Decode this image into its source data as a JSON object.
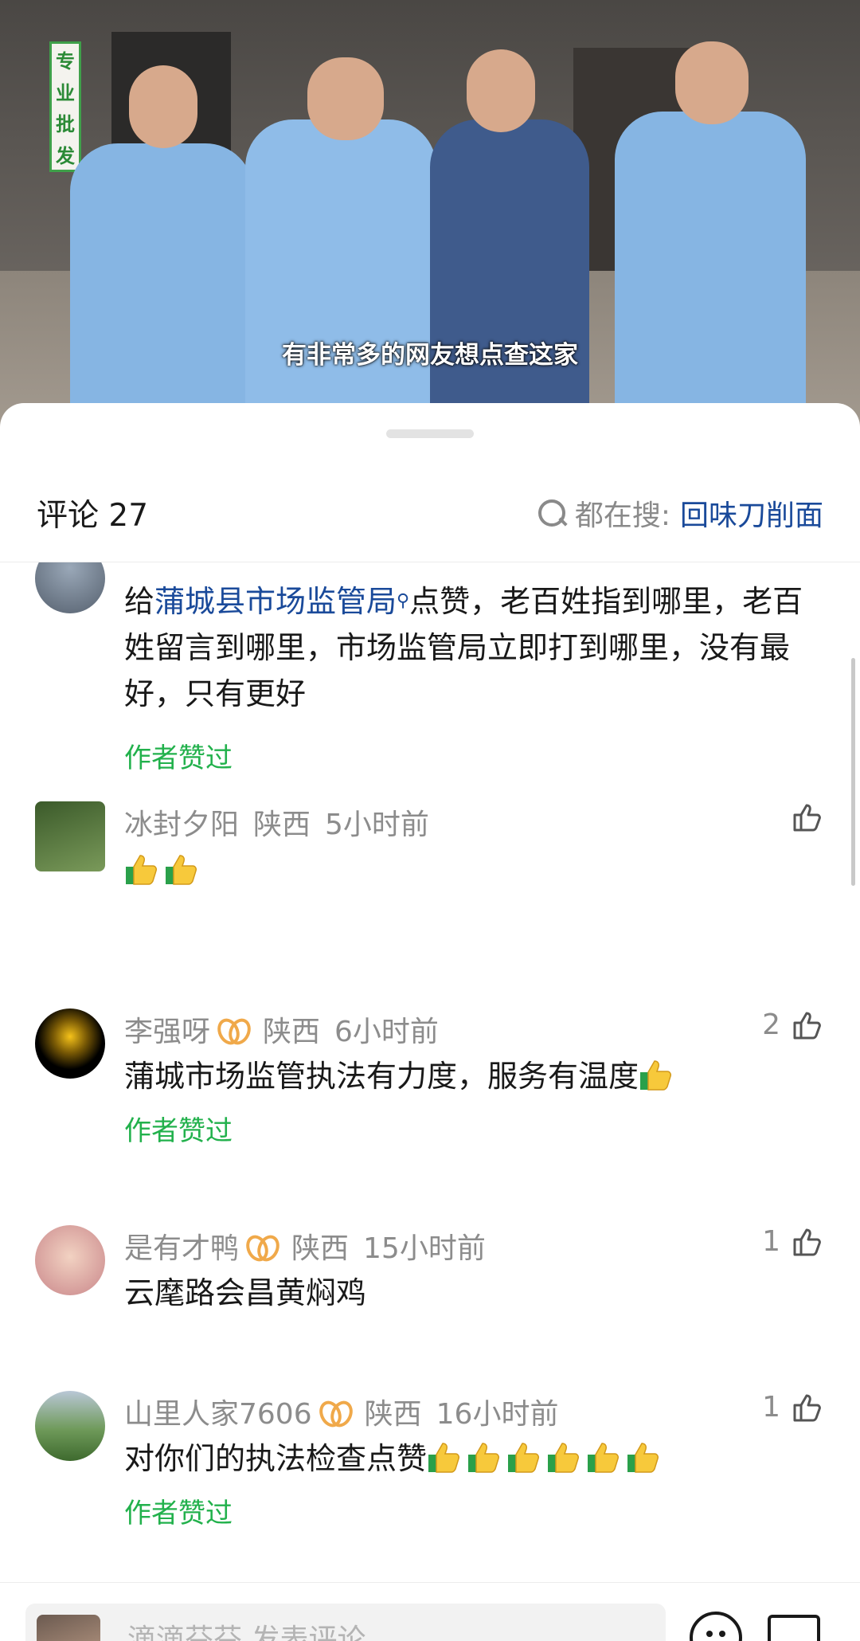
{
  "video": {
    "caption": "有非常多的网友想点查这家",
    "store_sign": [
      "专",
      "业",
      "批",
      "发"
    ]
  },
  "sheet": {
    "comment_title": "评论 27",
    "search_label": "都在搜:",
    "search_link": "回味刀削面"
  },
  "comments": [
    {
      "body_prefix": "给",
      "body_link": "蒲城县市场监管局",
      "body_rest": "点赞，老百姓指到哪里，老百姓留言到哪里，市场监管局立即打到哪里，没有最好，只有更好",
      "author_liked": "作者赞过"
    },
    {
      "username": "冰封夕阳",
      "region": "陕西",
      "time": "5小时前",
      "emoji_count": 2
    },
    {
      "username": "李强呀",
      "region": "陕西",
      "time": "6小时前",
      "likes": "2",
      "body": "蒲城市场监管执法有力度，服务有温度",
      "author_liked": "作者赞过"
    },
    {
      "username": "是有才鸭",
      "region": "陕西",
      "time": "15小时前",
      "likes": "1",
      "body": "云麾路会昌黄焖鸡"
    },
    {
      "username": "山里人家7606",
      "region": "陕西",
      "time": "16小时前",
      "likes": "1",
      "body": "对你们的执法检查点赞",
      "author_liked": "作者赞过"
    }
  ],
  "input": {
    "placeholder": "滴滴芬芬 发表评论"
  },
  "icons": {
    "search": "search-icon",
    "like": "thumb-up-icon",
    "emoji": "thumbs-up-emoji",
    "emoji_button": "emoji-icon",
    "image_button": "image-icon"
  },
  "colors": {
    "link": "#1a4a9a",
    "author_liked": "#22b14c",
    "meta": "#8c8c8c",
    "badge": "#f0a94a"
  }
}
